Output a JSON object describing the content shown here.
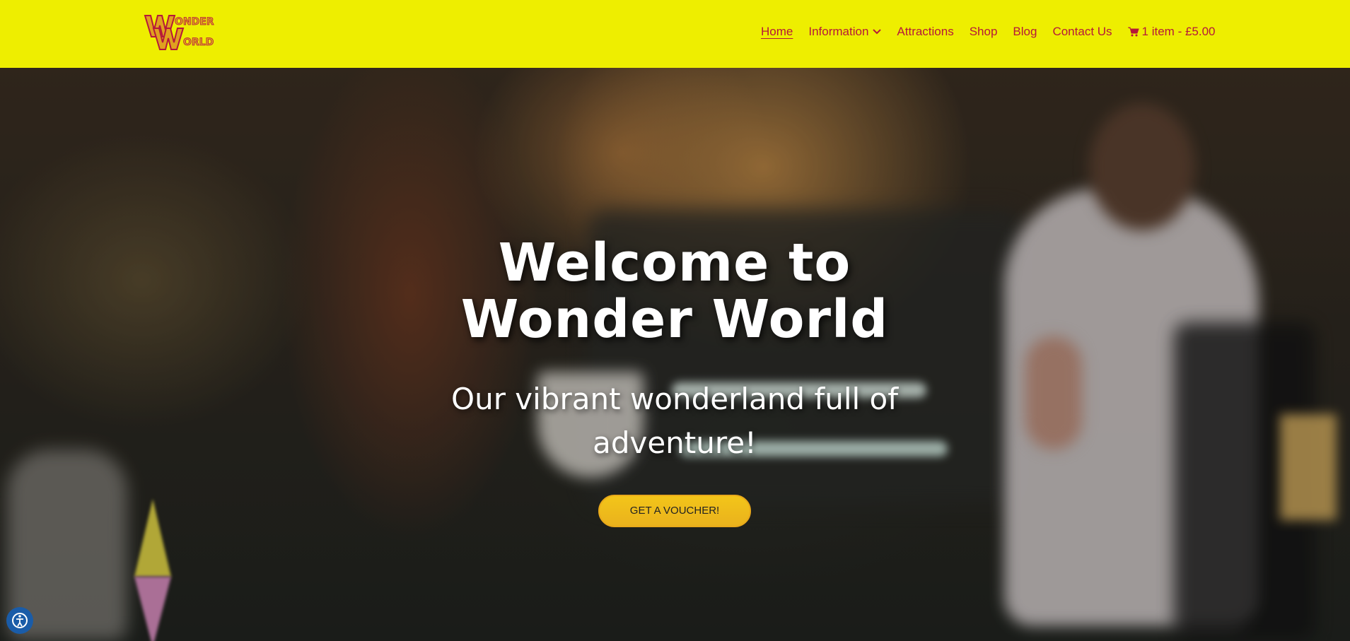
{
  "header": {
    "logo_text": "Wonder World",
    "logo_line1": "ONDER",
    "logo_line2": "ORLD",
    "brand_color": "#eeee00",
    "nav_color": "#b5183a"
  },
  "nav": {
    "home": "Home",
    "information": "Information",
    "attractions": "Attractions",
    "shop": "Shop",
    "blog": "Blog",
    "contact": "Contact Us",
    "cart": "1 item - £5.00"
  },
  "hero": {
    "title": "Welcome to Wonder World",
    "subtitle": "Our vibrant wonderland full of adventure!",
    "button_label": "GET A VOUCHER!",
    "button_color": "#f3c51a"
  },
  "icons": {
    "dropdown": "chevron-down-icon",
    "cart": "shopping-cart-icon",
    "accessibility": "accessibility-icon"
  }
}
